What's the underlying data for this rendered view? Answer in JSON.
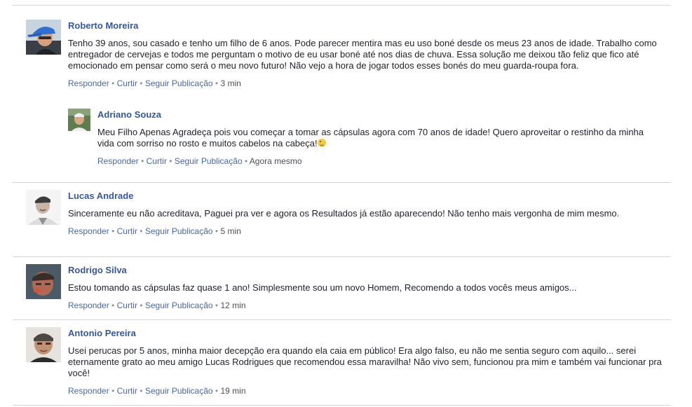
{
  "comments": [
    {
      "author": "Roberto Moreira",
      "text": "Tenho 39 anos, sou casado e tenho um filho de 6 anos. Pode parecer mentira mas eu uso boné desde os meus 23 anos de idade. Trabalho como entregador de cervejas e todos me perguntam o motivo de eu usar boné até nos dias de chuva. Essa solução me deixou tão feliz que fico até emocionado em pensar como será o meu novo futuro! Não vejo a hora de jogar todos esses bonés do meu guarda-roupa fora.",
      "reply_label": "Responder",
      "like_label": "Curtir",
      "follow_label": "Seguir Publicação",
      "time": "3 min",
      "replies": [
        {
          "author": "Adriano Souza",
          "text": "Meu Filho Apenas Agradeça pois vou começar a tomar as cápsulas agora com 70 anos de idade! Quero aproveitar o restinho da minha vida com sorriso no rosto e muitos cabelos na cabeça!",
          "emoji": "winking-face-emoji",
          "reply_label": "Responder",
          "like_label": "Curtir",
          "follow_label": "Seguir Publicação",
          "time": "Agora mesmo"
        }
      ]
    },
    {
      "author": "Lucas Andrade",
      "text": "Sinceramente eu não acreditava, Paguei pra ver e agora os Resultados já estão aparecendo! Não tenho mais vergonha de mim mesmo.",
      "reply_label": "Responder",
      "like_label": "Curtir",
      "follow_label": "Seguir Publicação",
      "time": "5 min"
    },
    {
      "author": "Rodrigo Silva",
      "text": "Estou tomando as cápsulas faz quase 1 ano! Simplesmente sou um novo Homem, Recomendo a todos vocês meus amigos...",
      "reply_label": "Responder",
      "like_label": "Curtir",
      "follow_label": "Seguir Publicação",
      "time": "12 min"
    },
    {
      "author": "Antonio Pereira",
      "text": "Usei perucas por 5 anos, minha maior decepção era quando ela caia em público! Era algo falso, eu não me sentia seguro com aquilo... serei eternamente grato ao meu amigo Lucas Rodrigues que recomendou essa maravilha! Não vivo sem, funcionou pra mim e também vai funcionar pra você!",
      "reply_label": "Responder",
      "like_label": "Curtir",
      "follow_label": "Seguir Publicação",
      "time": "19 min"
    }
  ],
  "separator": "•",
  "colors": {
    "author_link": "#365899",
    "action_link": "#4b67a1",
    "body_text": "#1d2129",
    "meta_text": "#90949c",
    "divider": "#d3d6db"
  }
}
